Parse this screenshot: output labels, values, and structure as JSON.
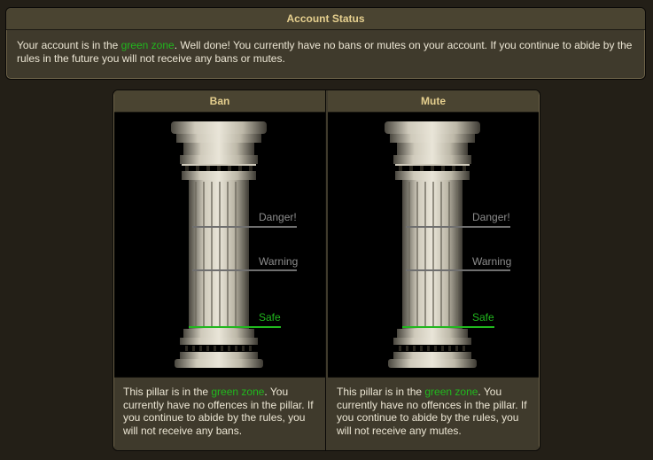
{
  "account_status": {
    "title": "Account Status",
    "text_before": "Your account is in the ",
    "highlight": "green zone",
    "text_after": ". Well done! You currently have no bans or mutes on your account. If you continue to abide by the rules in the future you will not receive any bans or mutes."
  },
  "pillars": [
    {
      "title": "Ban",
      "labels": {
        "danger": "Danger!",
        "warning": "Warning",
        "safe": "Safe"
      },
      "level": 0,
      "desc_before": "This pillar is in the ",
      "desc_highlight": "green zone",
      "desc_after": ". You currently have no offences in the pillar. If you continue to abide by the rules, you will not receive any bans."
    },
    {
      "title": "Mute",
      "labels": {
        "danger": "Danger!",
        "warning": "Warning",
        "safe": "Safe"
      },
      "level": 0,
      "desc_before": "This pillar is in the ",
      "desc_highlight": "green zone",
      "desc_after": ". You currently have no offences in the pillar. If you continue to abide by the rules, you will not receive any mutes."
    }
  ],
  "colors": {
    "green_zone": "#21b81e",
    "heading": "#e5cf8e",
    "neutral_label": "#8c8c8c"
  }
}
